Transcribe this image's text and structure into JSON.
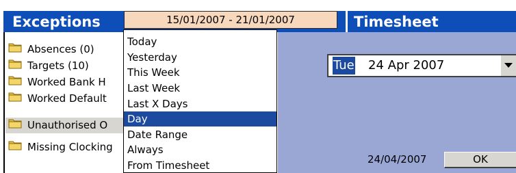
{
  "exceptions": {
    "title": "Exceptions",
    "date_range": "15/01/2007 - 21/01/2007",
    "items": [
      {
        "label": "Absences (0)"
      },
      {
        "label": "Targets (10)"
      },
      {
        "label": "Worked Bank H"
      },
      {
        "label": "Worked Default"
      },
      {
        "label": "Unauthorised O"
      },
      {
        "label": "Missing Clocking"
      }
    ]
  },
  "dropdown": {
    "options": [
      {
        "label": "Today"
      },
      {
        "label": "Yesterday"
      },
      {
        "label": "This Week"
      },
      {
        "label": "Last Week"
      },
      {
        "label": "Last X Days"
      },
      {
        "label": "Day"
      },
      {
        "label": "Date Range"
      },
      {
        "label": "Always"
      },
      {
        "label": "From Timesheet"
      }
    ],
    "selected": "Day"
  },
  "timesheet": {
    "title": "Timesheet",
    "picker_day": "Tue",
    "picker_date": "24 Apr 2007",
    "date_label": "24/04/2007",
    "ok_label": "OK"
  },
  "colors": {
    "header_blue": "#0e4eb8",
    "selection_blue": "#1c4aa0",
    "panel_bg": "#9aa7d4",
    "combo_bg": "#f7d8bd"
  }
}
